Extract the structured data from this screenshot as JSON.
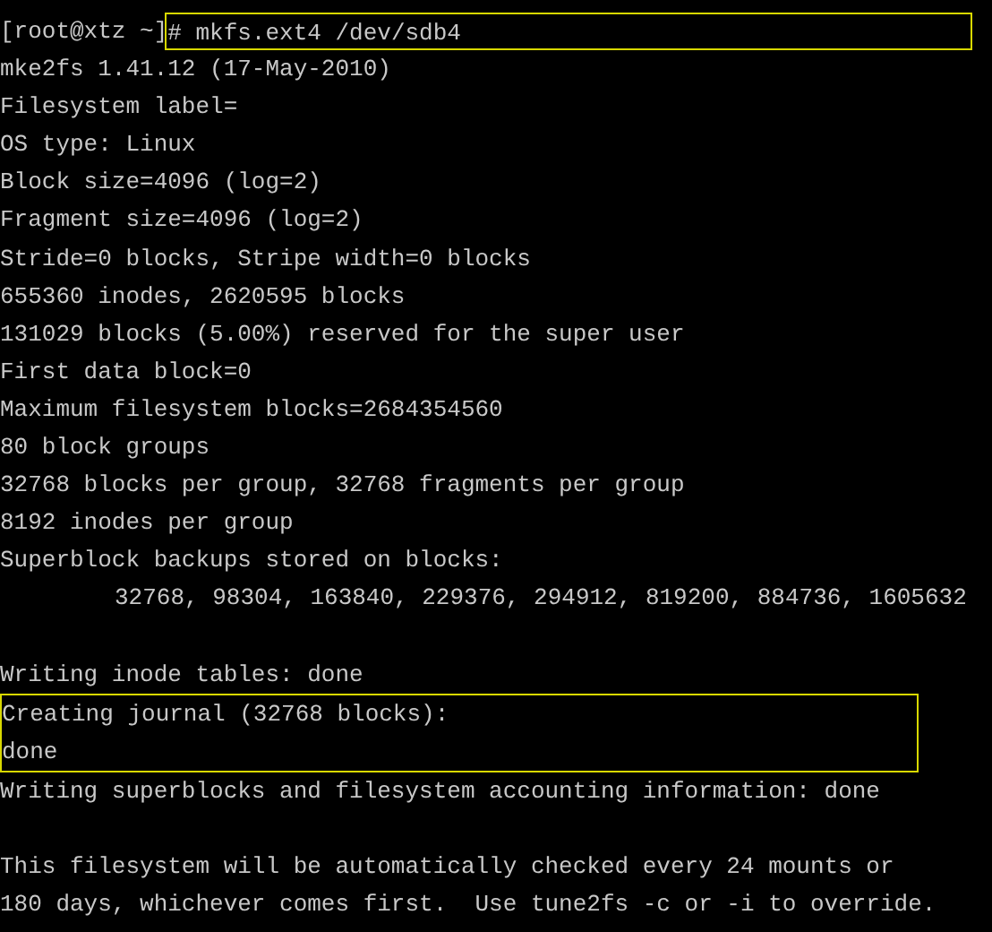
{
  "terminal": {
    "blocks": [
      {
        "kind": "prompt",
        "prompt": "[root@xtz ~]",
        "command": "# mkfs.ext4 /dev/sdb4",
        "highlighted": true
      },
      {
        "kind": "output",
        "highlighted": false,
        "lines": [
          {
            "text": "mke2fs 1.41.12 (17-May-2010)",
            "indent": false
          },
          {
            "text": "Filesystem label=",
            "indent": false
          },
          {
            "text": "OS type: Linux",
            "indent": false
          },
          {
            "text": "Block size=4096 (log=2)",
            "indent": false
          },
          {
            "text": "Fragment size=4096 (log=2)",
            "indent": false
          },
          {
            "text": "Stride=0 blocks, Stripe width=0 blocks",
            "indent": false
          },
          {
            "text": "655360 inodes, 2620595 blocks",
            "indent": false
          },
          {
            "text": "131029 blocks (5.00%) reserved for the super user",
            "indent": false
          },
          {
            "text": "First data block=0",
            "indent": false
          },
          {
            "text": "Maximum filesystem blocks=2684354560",
            "indent": false
          },
          {
            "text": "80 block groups",
            "indent": false
          },
          {
            "text": "32768 blocks per group, 32768 fragments per group",
            "indent": false
          },
          {
            "text": "8192 inodes per group",
            "indent": false
          },
          {
            "text": "Superblock backups stored on blocks:",
            "indent": false
          },
          {
            "text": "32768, 98304, 163840, 229376, 294912, 819200, 884736, 1605632",
            "indent": true
          }
        ]
      },
      {
        "kind": "blank"
      },
      {
        "kind": "output",
        "highlighted": false,
        "lines": [
          {
            "text": "Writing inode tables: done",
            "indent": false
          }
        ]
      },
      {
        "kind": "output",
        "highlighted": true,
        "lines": [
          {
            "text": "Creating journal (32768 blocks):",
            "indent": false
          },
          {
            "text": "done",
            "indent": false
          }
        ]
      },
      {
        "kind": "output",
        "highlighted": false,
        "lines": [
          {
            "text": "Writing superblocks and filesystem accounting information: done",
            "indent": false
          }
        ]
      },
      {
        "kind": "blank"
      },
      {
        "kind": "output",
        "highlighted": false,
        "lines": [
          {
            "text": "This filesystem will be automatically checked every 24 mounts or",
            "indent": false
          },
          {
            "text": "180 days, whichever comes first.  Use tune2fs -c or -i to override.",
            "indent": false
          }
        ]
      }
    ]
  }
}
